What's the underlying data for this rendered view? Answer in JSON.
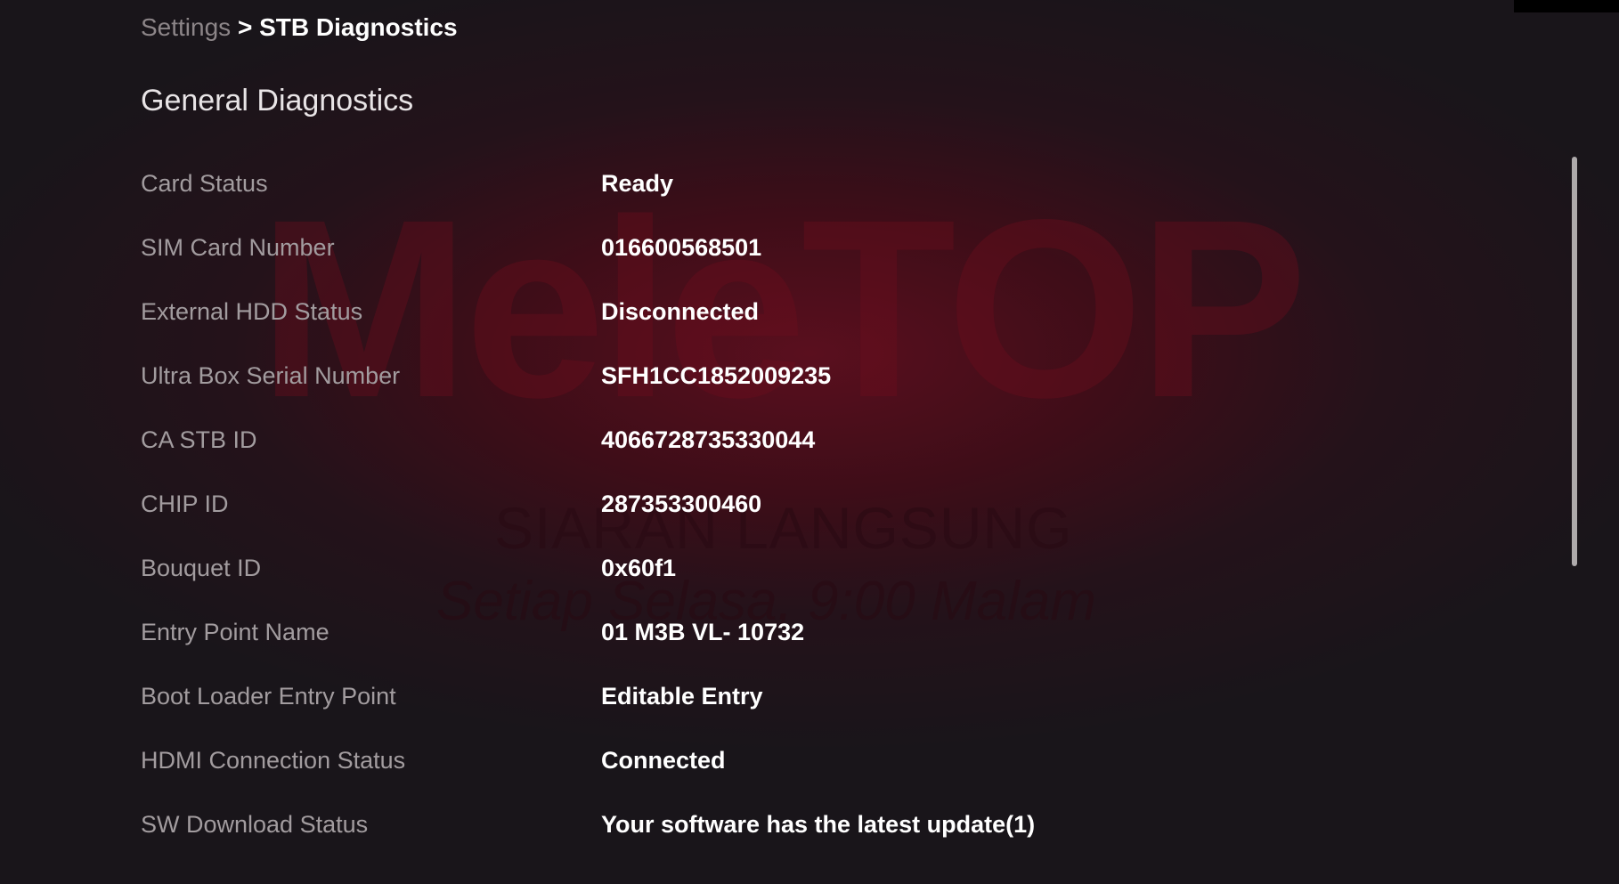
{
  "breadcrumb": {
    "parent": "Settings",
    "separator": ">",
    "current": "STB Diagnostics"
  },
  "section": {
    "title": "General Diagnostics"
  },
  "background": {
    "logo_text": "MeleTOP",
    "line1": "SIARAN LANGSUNG",
    "line2": "Setiap Selasa, 9:00 Malam"
  },
  "diagnostics": [
    {
      "label": "Card Status",
      "value": "Ready"
    },
    {
      "label": "SIM Card Number",
      "value": "016600568501"
    },
    {
      "label": "External HDD Status",
      "value": "Disconnected"
    },
    {
      "label": "Ultra Box Serial Number",
      "value": "SFH1CC1852009235"
    },
    {
      "label": "CA STB ID",
      "value": "4066728735330044"
    },
    {
      "label": "CHIP ID",
      "value": "287353300460"
    },
    {
      "label": "Bouquet ID",
      "value": "0x60f1"
    },
    {
      "label": "Entry Point Name",
      "value": "01 M3B VL- 10732"
    },
    {
      "label": "Boot Loader Entry Point",
      "value": "Editable Entry"
    },
    {
      "label": "HDMI Connection Status",
      "value": "Connected"
    },
    {
      "label": "SW Download Status",
      "value": "Your software has the latest update(1)"
    }
  ],
  "colors": {
    "background": "#1a1416",
    "accent_red": "#5a0f1e",
    "label_text": "#a29c9f",
    "value_text": "#ffffff"
  }
}
